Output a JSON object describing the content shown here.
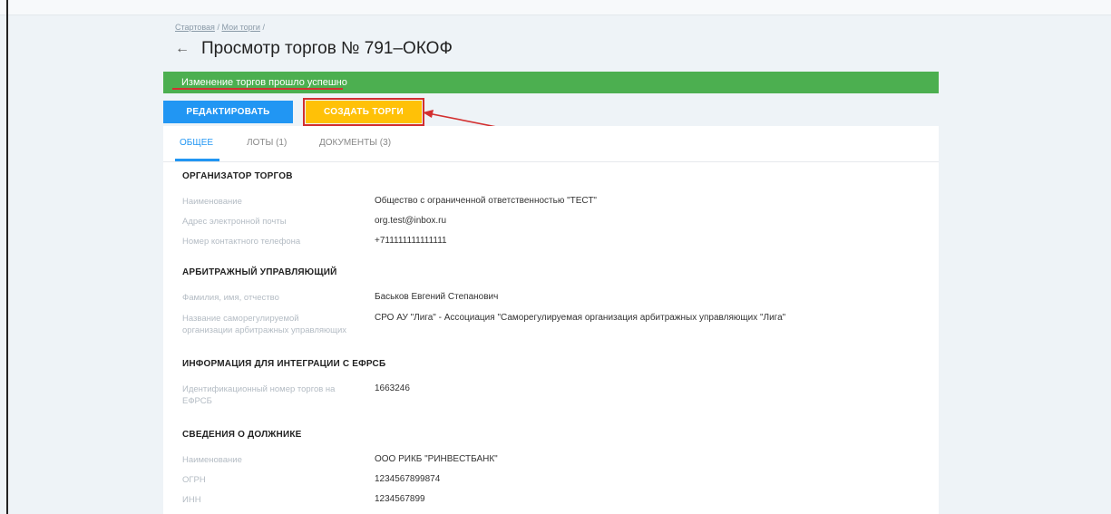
{
  "breadcrumb": {
    "home": "Стартовая",
    "separator": "/",
    "my_trades": "Мои торги"
  },
  "page": {
    "title": "Просмотр торгов № 791–ОКОФ"
  },
  "alert": {
    "message": "Изменение торгов прошло успешно"
  },
  "toolbar": {
    "edit_label": "РЕДАКТИРОВАТЬ",
    "create_label": "СОЗДАТЬ ТОРГИ"
  },
  "tabs": [
    {
      "label": "ОБЩЕЕ",
      "active": true
    },
    {
      "label": "ЛОТЫ (1)",
      "active": false
    },
    {
      "label": "ДОКУМЕНТЫ (3)",
      "active": false
    }
  ],
  "organizer": {
    "heading": "ОРГАНИЗАТОР ТОРГОВ",
    "name_label": "Наименование",
    "name_value": "Общество с ограниченной ответственностью \"ТЕСТ\"",
    "email_label": "Адрес электронной почты",
    "email_value": "org.test@inbox.ru",
    "phone_label": "Номер контактного телефона",
    "phone_value": "+711111111111111"
  },
  "manager": {
    "heading": "АРБИТРАЖНЫЙ УПРАВЛЯЮЩИЙ",
    "fio_label": "Фамилия, имя, отчество",
    "fio_value": "Баськов Евгений Степанович",
    "sro_label": "Название саморегулируемой организации арбитражных управляющих",
    "sro_value": "СРО АУ \"Лига\" - Ассоциация \"Саморегулируемая организация арбитражных управляющих \"Лига\""
  },
  "efrsb": {
    "heading": "ИНФОРМАЦИЯ ДЛЯ ИНТЕГРАЦИИ С ЕФРСБ",
    "id_label": "Идентификационный номер торгов на ЕФРСБ",
    "id_value": "1663246"
  },
  "debtor": {
    "heading": "СВЕДЕНИЯ О ДОЛЖНИКЕ",
    "name_label": "Наименование",
    "name_value": "ООО РИКБ \"РИНВЕСТБАНК\"",
    "ogrn_label": "ОГРН",
    "ogrn_value": "1234567899874",
    "inn_label": "ИНН",
    "inn_value": "1234567899"
  },
  "colors": {
    "success": "#4caf50",
    "primary": "#2196f3",
    "warning": "#ffc107",
    "highlight": "#d32f2f"
  },
  "icons": {
    "back": "arrow-left-icon"
  }
}
